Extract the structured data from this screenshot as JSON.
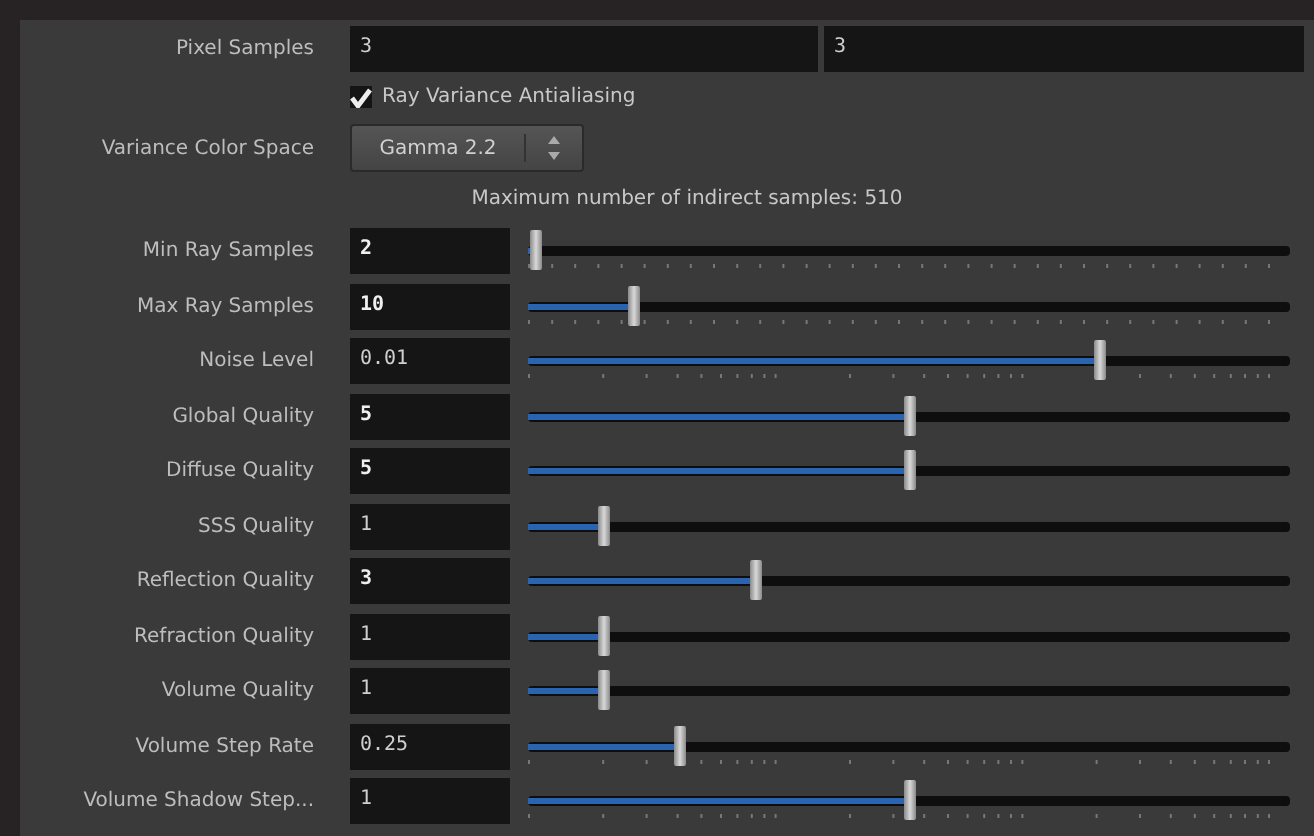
{
  "pixel_samples": {
    "label": "Pixel Samples",
    "values": [
      "3",
      "3"
    ]
  },
  "ray_variance": {
    "label": "Ray Variance Antialiasing",
    "checked": true
  },
  "variance_color_space": {
    "label": "Variance Color Space",
    "value": "Gamma 2.2"
  },
  "info": "Maximum number of indirect samples: 510",
  "sliders": [
    {
      "label": "Min Ray Samples",
      "value": "2",
      "modified": true,
      "level": 0.01,
      "kind": "ticked"
    },
    {
      "label": "Max Ray Samples",
      "value": "10",
      "modified": true,
      "level": 0.14,
      "kind": "ticked"
    },
    {
      "label": "Noise Level",
      "value": "0.01",
      "modified": false,
      "level": 0.75,
      "kind": "log"
    },
    {
      "label": "Global Quality",
      "value": "5",
      "modified": true,
      "level": 0.5,
      "kind": "plain"
    },
    {
      "label": "Diffuse Quality",
      "value": "5",
      "modified": true,
      "level": 0.5,
      "kind": "plain"
    },
    {
      "label": "SSS Quality",
      "value": "1",
      "modified": false,
      "level": 0.1,
      "kind": "plain"
    },
    {
      "label": "Reflection Quality",
      "value": "3",
      "modified": true,
      "level": 0.3,
      "kind": "plain"
    },
    {
      "label": "Refraction Quality",
      "value": "1",
      "modified": false,
      "level": 0.1,
      "kind": "plain"
    },
    {
      "label": "Volume Quality",
      "value": "1",
      "modified": false,
      "level": 0.1,
      "kind": "plain"
    },
    {
      "label": "Volume Step Rate",
      "value": "0.25",
      "modified": false,
      "level": 0.2,
      "kind": "log"
    },
    {
      "label": "Volume Shadow Step...",
      "value": "1",
      "modified": false,
      "level": 0.5,
      "kind": "log"
    }
  ]
}
